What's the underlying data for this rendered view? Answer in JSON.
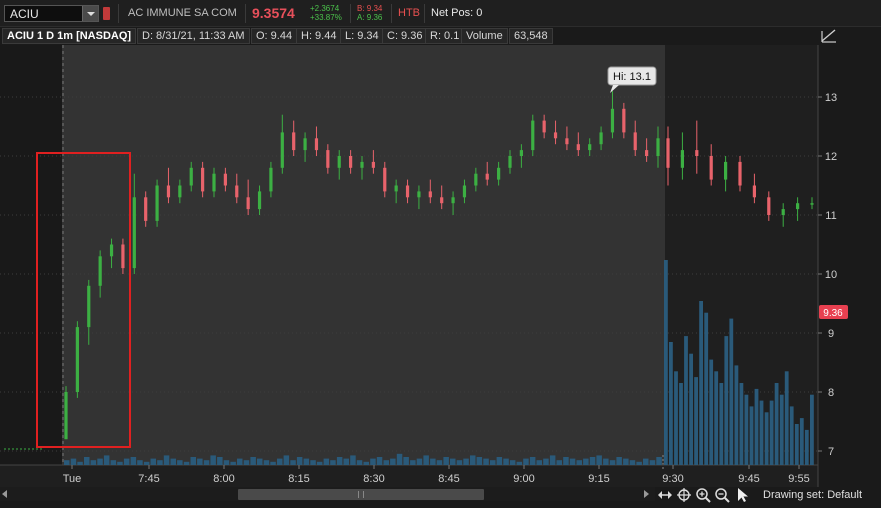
{
  "header": {
    "symbol": "ACIU",
    "company": "AC IMMUNE SA COM",
    "last_price": "9.3574",
    "change_abs": "+2.3674",
    "change_pct": "+33.87%",
    "bid": "B: 9.34",
    "ask": "A: 9.36",
    "htb": "HTB",
    "net_pos": "Net Pos: 0"
  },
  "info": {
    "title": "ACIU 1 D 1m [NASDAQ]",
    "datetime": "D: 8/31/21, 11:33 AM",
    "open": "O: 9.44",
    "high": "H: 9.44",
    "low": "L: 9.34",
    "close": "C: 9.36",
    "range": "R: 0.1",
    "volume_label": "Volume",
    "volume_value": "63,548"
  },
  "colors": {
    "up": "#3cb043",
    "down": "#e8636b",
    "volume": "#2a5a7a",
    "annotation_box": "#e02020",
    "price_tag": "#e84050"
  },
  "chart_data": {
    "type": "candlestick",
    "y_ticks": [
      7,
      8,
      9,
      10,
      11,
      12,
      13
    ],
    "ylim": [
      6.85,
      13.9
    ],
    "x_labels": [
      "Tue",
      "7:45",
      "8:00",
      "8:15",
      "8:30",
      "8:45",
      "9:00",
      "9:15",
      "9:30",
      "9:45",
      "9:55"
    ],
    "hi_label": "Hi: 13.1",
    "last_price_tag": "9.36",
    "session_open_label": "9:30",
    "candles_ohlc_approx": [
      [
        7.2,
        8.1,
        7.2,
        8.0
      ],
      [
        8.0,
        9.2,
        7.9,
        9.1
      ],
      [
        9.1,
        9.9,
        8.8,
        9.8
      ],
      [
        9.8,
        10.4,
        9.6,
        10.3
      ],
      [
        10.3,
        10.6,
        10.1,
        10.5
      ],
      [
        10.5,
        10.6,
        10.0,
        10.1
      ],
      [
        10.1,
        11.7,
        10.0,
        11.3
      ],
      [
        11.3,
        11.4,
        10.8,
        10.9
      ],
      [
        10.9,
        11.6,
        10.8,
        11.5
      ],
      [
        11.5,
        11.8,
        11.2,
        11.3
      ],
      [
        11.3,
        11.6,
        11.2,
        11.5
      ],
      [
        11.5,
        11.9,
        11.4,
        11.8
      ],
      [
        11.8,
        11.9,
        11.3,
        11.4
      ],
      [
        11.4,
        11.8,
        11.3,
        11.7
      ],
      [
        11.7,
        11.8,
        11.4,
        11.5
      ],
      [
        11.5,
        11.7,
        11.2,
        11.3
      ],
      [
        11.3,
        11.6,
        11.0,
        11.1
      ],
      [
        11.1,
        11.5,
        11.0,
        11.4
      ],
      [
        11.4,
        11.9,
        11.3,
        11.8
      ],
      [
        11.8,
        12.7,
        11.7,
        12.4
      ],
      [
        12.4,
        12.6,
        12.0,
        12.1
      ],
      [
        12.1,
        12.4,
        11.9,
        12.3
      ],
      [
        12.3,
        12.5,
        12.0,
        12.1
      ],
      [
        12.1,
        12.2,
        11.7,
        11.8
      ],
      [
        11.8,
        12.1,
        11.6,
        12.0
      ],
      [
        12.0,
        12.1,
        11.7,
        11.8
      ],
      [
        11.8,
        12.0,
        11.6,
        11.9
      ],
      [
        11.9,
        12.1,
        11.7,
        11.8
      ],
      [
        11.8,
        11.9,
        11.3,
        11.4
      ],
      [
        11.4,
        11.6,
        11.2,
        11.5
      ],
      [
        11.5,
        11.6,
        11.2,
        11.3
      ],
      [
        11.3,
        11.5,
        11.1,
        11.4
      ],
      [
        11.4,
        11.6,
        11.2,
        11.3
      ],
      [
        11.3,
        11.5,
        11.1,
        11.2
      ],
      [
        11.2,
        11.4,
        11.0,
        11.3
      ],
      [
        11.3,
        11.6,
        11.2,
        11.5
      ],
      [
        11.5,
        11.8,
        11.4,
        11.7
      ],
      [
        11.7,
        11.9,
        11.5,
        11.6
      ],
      [
        11.6,
        11.9,
        11.5,
        11.8
      ],
      [
        11.8,
        12.1,
        11.7,
        12.0
      ],
      [
        12.0,
        12.2,
        11.8,
        12.1
      ],
      [
        12.1,
        12.7,
        12.0,
        12.6
      ],
      [
        12.6,
        12.7,
        12.3,
        12.4
      ],
      [
        12.4,
        12.6,
        12.2,
        12.3
      ],
      [
        12.3,
        12.5,
        12.1,
        12.2
      ],
      [
        12.2,
        12.4,
        12.0,
        12.1
      ],
      [
        12.1,
        12.3,
        12.0,
        12.2
      ],
      [
        12.2,
        12.5,
        12.1,
        12.4
      ],
      [
        12.4,
        13.1,
        12.3,
        12.8
      ],
      [
        12.8,
        12.9,
        12.3,
        12.4
      ],
      [
        12.4,
        12.6,
        12.0,
        12.1
      ],
      [
        12.1,
        12.3,
        11.9,
        12.0
      ],
      [
        12.0,
        12.5,
        11.8,
        12.3
      ],
      [
        12.3,
        12.5,
        11.5,
        11.8
      ],
      [
        11.8,
        12.4,
        11.6,
        12.1
      ],
      [
        12.1,
        12.6,
        11.7,
        12.0
      ],
      [
        12.0,
        12.2,
        11.5,
        11.6
      ],
      [
        11.6,
        12.0,
        11.4,
        11.9
      ],
      [
        11.9,
        12.0,
        11.4,
        11.5
      ],
      [
        11.5,
        11.7,
        11.2,
        11.3
      ],
      [
        11.3,
        11.4,
        10.9,
        11.0
      ],
      [
        11.0,
        11.2,
        10.8,
        11.1
      ],
      [
        11.1,
        11.3,
        10.9,
        11.2
      ],
      [
        11.2,
        11.3,
        11.1,
        11.2
      ]
    ],
    "volume_premarket_approx": [
      3,
      4,
      2,
      5,
      3,
      4,
      6,
      3,
      2,
      4,
      5,
      3,
      2,
      4,
      3,
      6,
      4,
      3,
      2,
      5,
      4,
      3,
      6,
      5,
      3,
      2,
      4,
      3,
      5,
      4,
      3,
      2,
      4,
      6,
      3,
      5,
      4,
      3,
      2,
      4,
      3,
      5,
      4,
      6,
      3,
      2,
      4,
      5,
      3,
      4,
      7,
      5,
      3,
      4,
      6,
      4,
      3,
      5,
      4,
      3,
      4,
      6,
      5,
      4,
      3,
      5,
      4,
      3,
      2,
      4,
      5,
      3,
      4,
      6,
      3,
      5,
      4,
      3,
      4,
      5,
      6,
      4,
      3,
      5,
      4,
      3,
      2,
      4,
      3,
      5
    ],
    "volume_regular_approx": [
      35,
      21,
      16,
      14,
      22,
      19,
      15,
      28,
      26,
      18,
      16,
      14,
      22,
      25,
      17,
      14,
      12,
      10,
      13,
      11,
      9,
      11,
      14,
      12,
      16,
      10,
      7,
      8,
      6,
      12
    ]
  },
  "footer": {
    "drawing_set": "Drawing set: Default"
  }
}
